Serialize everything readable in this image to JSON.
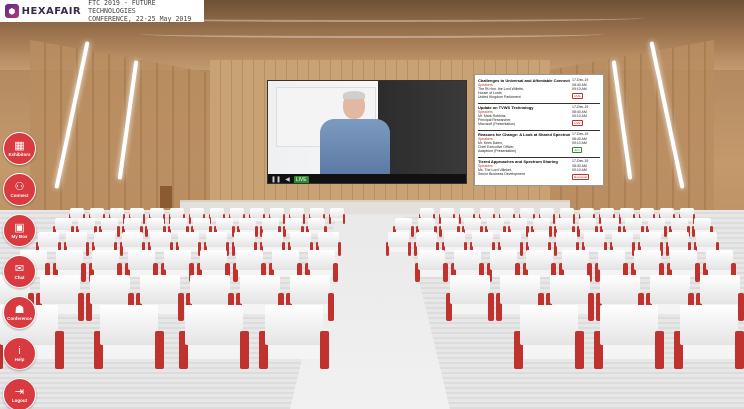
{
  "header": {
    "logo_text": "HEXAFAIR",
    "conference_line1": "FTC 2019 - FUTURE TECHNOLOGIES",
    "conference_line2": "CONFERENCE, 22-25 May 2019"
  },
  "nav": [
    {
      "label": "Exhibitors",
      "icon": "building-icon"
    },
    {
      "label": "Connect",
      "icon": "network-icon"
    },
    {
      "label": "My Box",
      "icon": "briefcase-icon"
    },
    {
      "label": "Chat",
      "icon": "chat-icon"
    },
    {
      "label": "Conference",
      "icon": "conference-icon"
    },
    {
      "label": "Help",
      "icon": "info-icon"
    },
    {
      "label": "Logout",
      "icon": "logout-icon"
    }
  ],
  "video": {
    "live_label": "LIVE"
  },
  "schedule": [
    {
      "title": "Challenges to Universal and Affordable Connectivity",
      "speakers_label": "Speakers",
      "speakers": [
        "The Rt Hon. the Lord Willetts,",
        "House of Lords",
        "United Kingdom Parliament"
      ],
      "date": "17-Dec-19",
      "start": "08:40 AM",
      "end": "09:10 AM",
      "status": "LIVE"
    },
    {
      "title": "Update on TVWS Technology",
      "speakers_label": "Speakers",
      "speakers": [
        "Mr. Mark Robbins,",
        "Principal Researcher,",
        "Microsoft (Presentation)"
      ],
      "date": "17-Dec-19",
      "start": "08:40 AM",
      "end": "09:10 AM",
      "status": "LIVE"
    },
    {
      "title": "Reasons for Change: A Look at Shared Spectrum Use",
      "speakers_label": "Speakers",
      "speakers": [
        "Mr. Kees Dalen,",
        "Chief Executive Officer,",
        "Adaptrum (Presentation)"
      ],
      "date": "17-Dec-19",
      "start": "08:40 AM",
      "end": "09:10 AM",
      "status": "Join"
    },
    {
      "title": "Tiered Approaches and Spectrum Sharing",
      "speakers_label": "Speakers",
      "speakers": [
        "Ms. The Lord Villeket,",
        "Senior Business Development"
      ],
      "date": "17-Dec-19",
      "start": "08:40 AM",
      "end": "09:10 AM",
      "status": "Download"
    }
  ],
  "colors": {
    "accent": "#d83a3f",
    "chair_arm": "#c0322d"
  }
}
